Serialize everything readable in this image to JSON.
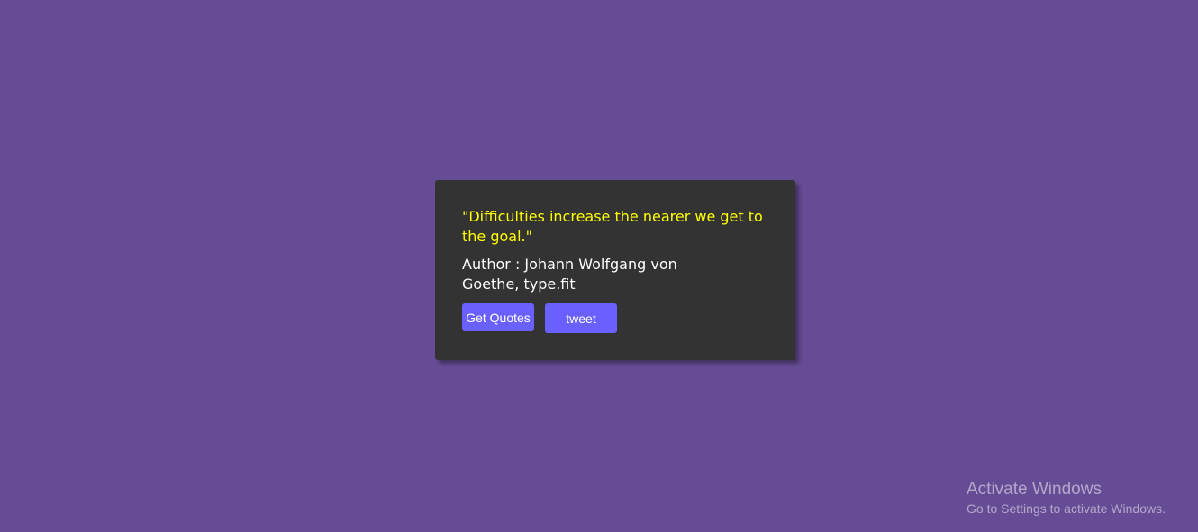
{
  "page": {
    "background_color": "#664c94"
  },
  "quote_card": {
    "background_color": "#333333",
    "quote_text": "\"Difficulties increase the nearer we get to the goal.\"",
    "quote_color": "#ffff00",
    "author_text": "Author : Johann Wolfgang von Goethe, type.fit",
    "get_quotes_label": "Get Quotes",
    "tweet_label": "tweet",
    "button_color": "#6a60ff"
  },
  "windows_watermark": {
    "title": "Activate Windows",
    "subtitle": "Go to Settings to activate Windows."
  }
}
